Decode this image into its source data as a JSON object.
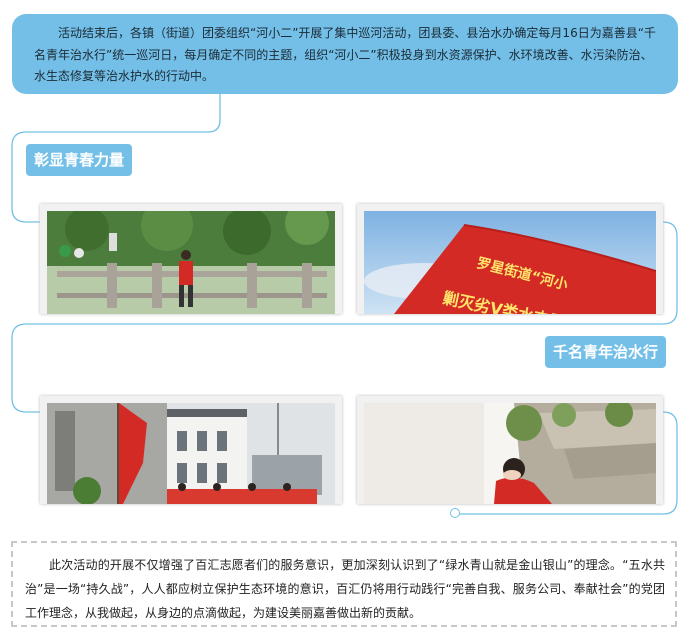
{
  "intro": {
    "text": "活动结束后，各镇（街道）团委组织“河小二”开展了集中巡河活动，团县委、县治水办确定每月16日为嘉善县“千名青年治水行”统一巡河日，每月确定不同的主题，组织“河小二”积极投身到水资源保护、水环境改善、水污染防治、水生态修复等治水护水的行动中。"
  },
  "sections": [
    {
      "heading": "彰显青春力量"
    },
    {
      "heading": "千名青年治水行"
    }
  ],
  "photos": {
    "flag_text_line1": "罗星街道“河小",
    "flag_text_line2": "剿灭劣Ⅴ类水志愿服务"
  },
  "closing": {
    "text": "此次活动的开展不仅增强了百汇志愿者们的服务意识，更加深刻认识到了“绿水青山就是金山银山”的理念。“五水共治”是一场“持久战”，人人都应树立保护生态环境的意识，百汇仍将用行动践行“完善自我、服务公司、奉献社会”的党团工作理念，从我做起，从身边的点滴做起，为建设美丽嘉善做出新的贡献。"
  },
  "colors": {
    "accent": "#73bfe7",
    "flag_red": "#d42a25"
  }
}
